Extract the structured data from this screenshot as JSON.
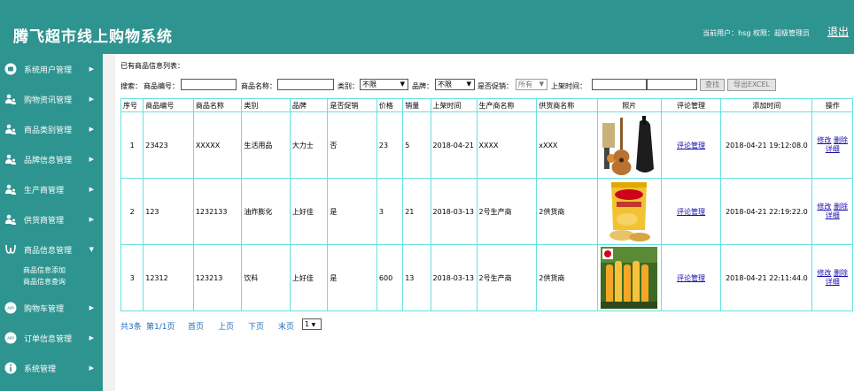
{
  "header": {
    "title": "腾飞超市线上购物系统",
    "user_info": "当前用户：hsg  权限：超级管理员",
    "logout_label": "退出"
  },
  "sidebar": {
    "items": [
      {
        "label": "系统用户管理",
        "icon": "user-circle-icon"
      },
      {
        "label": "购物资讯管理",
        "icon": "people-icon"
      },
      {
        "label": "商品类别管理",
        "icon": "people-icon"
      },
      {
        "label": "品牌信息管理",
        "icon": "people-icon"
      },
      {
        "label": "生产商管理",
        "icon": "people-icon"
      },
      {
        "label": "供货商管理",
        "icon": "people-icon"
      },
      {
        "label": "商品信息管理",
        "icon": "omega-icon"
      },
      {
        "label": "购物车管理",
        "icon": "app-icon"
      },
      {
        "label": "订单信息管理",
        "icon": "app-icon"
      },
      {
        "label": "系统管理",
        "icon": "info-icon"
      }
    ],
    "sub_items": [
      "商品信息添加",
      "商品信息查询"
    ]
  },
  "main": {
    "list_title": "已有商品信息列表：",
    "search": {
      "prefix": "搜索：",
      "code_label": "商品编号：",
      "name_label": "商品名称：",
      "category_label": "类别：",
      "category_value": "不限",
      "brand_label": "品牌：",
      "brand_value": "不限",
      "promo_label": "是否促销：",
      "promo_value": "所有",
      "time_label": "上架时间：",
      "search_button": "查找",
      "export_button": "导出EXCEL"
    },
    "table": {
      "headers": [
        "序号",
        "商品编号",
        "商品名称",
        "类别",
        "品牌",
        "是否促销",
        "价格",
        "销量",
        "上架时间",
        "生产商名称",
        "供货商名称",
        "照片",
        "评论管理",
        "添加时间",
        "操作"
      ],
      "rows": [
        {
          "no": "1",
          "code": "23423",
          "name": "XXXXX",
          "category": "生活用品",
          "brand": "大力士",
          "promo": "否",
          "price": "23",
          "sales": "5",
          "shelf_date": "2018-04-21",
          "producer": "XXXX",
          "supplier": "xXXX",
          "photo": "guitar",
          "comment": "评论管理",
          "added": "2018-04-21 19:12:08.0"
        },
        {
          "no": "2",
          "code": "123",
          "name": "1232133",
          "category": "油炸膨化",
          "brand": "上好佳",
          "promo": "是",
          "price": "3",
          "sales": "21",
          "shelf_date": "2018-03-13",
          "producer": "2号生产商",
          "supplier": "2供货商",
          "photo": "chips",
          "comment": "评论管理",
          "added": "2018-04-21 22:19:22.0"
        },
        {
          "no": "3",
          "code": "12312",
          "name": "123213",
          "category": "饮料",
          "brand": "上好佳",
          "promo": "是",
          "price": "600",
          "sales": "13",
          "shelf_date": "2018-03-13",
          "producer": "2号生产商",
          "supplier": "2供货商",
          "photo": "drinks",
          "comment": "评论管理",
          "added": "2018-04-21 22:11:44.0"
        }
      ],
      "op_edit": "修改",
      "op_delete": "删除",
      "op_detail": "详细"
    },
    "pager": {
      "total": "共3条",
      "page": "第1/1页",
      "first": "首页",
      "prev": "上页",
      "next": "下页",
      "last": "末页",
      "select_value": "1"
    }
  },
  "colors": {
    "teal": "#2e9490",
    "table_border": "#67e0e0",
    "link": "#1a0dab",
    "pager": "#1e6fb8"
  }
}
